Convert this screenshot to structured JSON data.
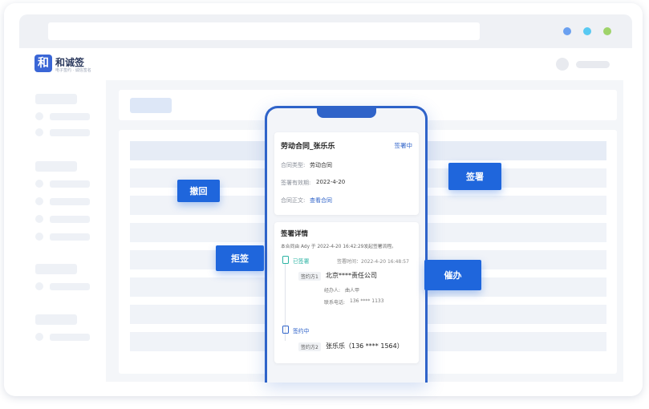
{
  "logo": {
    "mark": "和",
    "name": "和诚签",
    "slogan": "电子签约 · 诚信签名"
  },
  "contract": {
    "title": "劳动合同_张乐乐",
    "status": "签署中",
    "type_label": "合同类型:",
    "type_value": "劳动合同",
    "expiry_label": "签署有效期:",
    "expiry_value": "2022-4-20",
    "body_label": "合同正文:",
    "body_link": "查看合同"
  },
  "details": {
    "title": "签署详情",
    "subtitle": "本合同由 Ady 于 2022-4-20 16:42:29发起签署流程。",
    "party1": {
      "status": "已签署",
      "time": "签署时间：2022-4-20 16:48:57",
      "tag": "签约方1",
      "name": "北京****责任公司",
      "handler_label": "经办人:",
      "handler_value": "曲人甲",
      "phone_label": "联系电话:",
      "phone_value": "136 **** 1133"
    },
    "party2": {
      "status": "签约中",
      "tag": "签约方2",
      "name": "张乐乐（136 **** 1564）"
    }
  },
  "buttons": {
    "revoke": "撤回",
    "reject": "拒签",
    "sign": "签署",
    "urge": "催办"
  },
  "colors": {
    "primary": "#1f66dc",
    "signed": "#2bb3a3"
  }
}
